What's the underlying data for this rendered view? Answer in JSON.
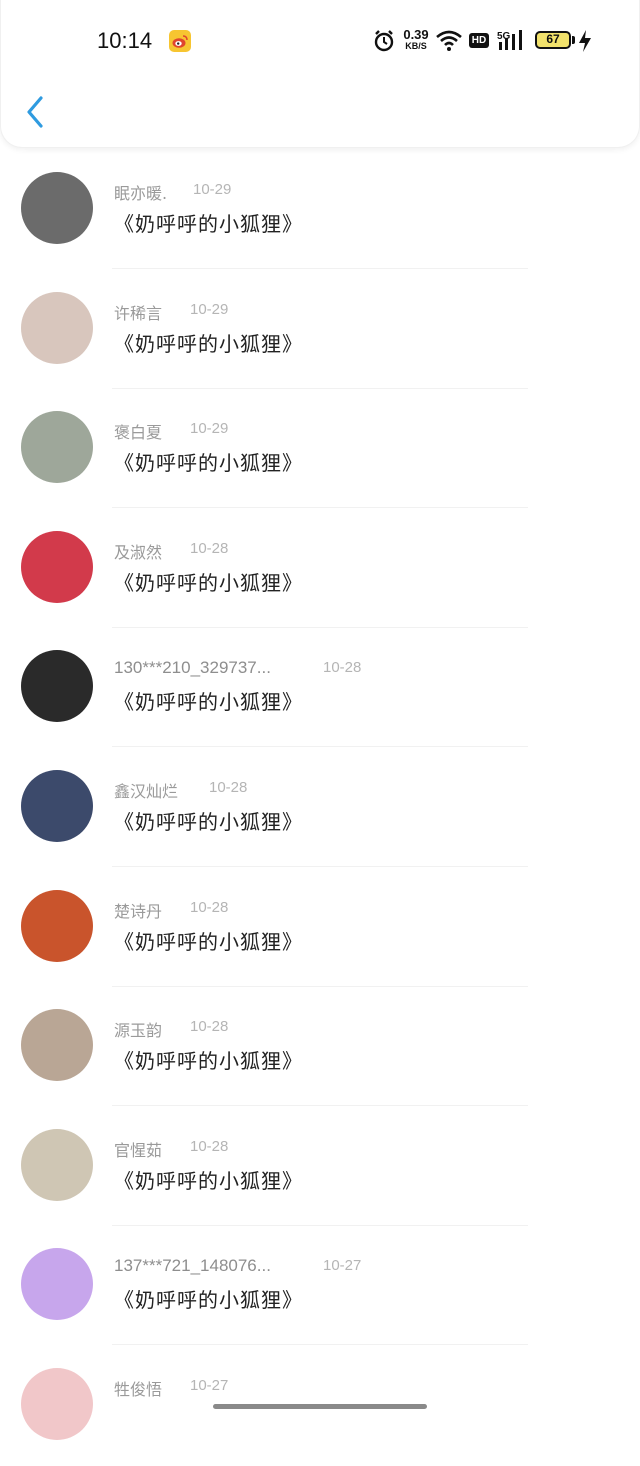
{
  "status_bar": {
    "time": "10:14",
    "net_speed_value": "0.39",
    "net_speed_unit": "KB/S",
    "hd_label": "HD",
    "signal_label": "5G",
    "battery_level": "67"
  },
  "header": {
    "back_icon": "chevron-left-icon",
    "accent_color": "#2f9be0"
  },
  "comments": [
    {
      "name": "眠亦暖.",
      "date": "10-29",
      "title": "《奶呼呼的小狐狸》",
      "avatar_color": "#6b6b6b"
    },
    {
      "name": "许稀言",
      "date": "10-29",
      "title": "《奶呼呼的小狐狸》",
      "avatar_color": "#d8c6bd"
    },
    {
      "name": "褒白夏",
      "date": "10-29",
      "title": "《奶呼呼的小狐狸》",
      "avatar_color": "#9ea79a"
    },
    {
      "name": "及淑然",
      "date": "10-28",
      "title": "《奶呼呼的小狐狸》",
      "avatar_color": "#d23a4b"
    },
    {
      "name": "130***210_329737...",
      "date": "10-28",
      "title": "《奶呼呼的小狐狸》",
      "avatar_color": "#2a2a2a"
    },
    {
      "name": "鑫汉灿烂",
      "date": "10-28",
      "title": "《奶呼呼的小狐狸》",
      "avatar_color": "#3c4a6b"
    },
    {
      "name": "楚诗丹",
      "date": "10-28",
      "title": "《奶呼呼的小狐狸》",
      "avatar_color": "#c9542c"
    },
    {
      "name": "源玉韵",
      "date": "10-28",
      "title": "《奶呼呼的小狐狸》",
      "avatar_color": "#b9a695"
    },
    {
      "name": "官惺茹",
      "date": "10-28",
      "title": "《奶呼呼的小狐狸》",
      "avatar_color": "#cfc6b4"
    },
    {
      "name": "137***721_148076...",
      "date": "10-27",
      "title": "《奶呼呼的小狐狸》",
      "avatar_color": "#c7a6ec"
    },
    {
      "name": "牲俊悟",
      "date": "10-27",
      "title": "",
      "avatar_color": "#f1c7c9"
    }
  ]
}
